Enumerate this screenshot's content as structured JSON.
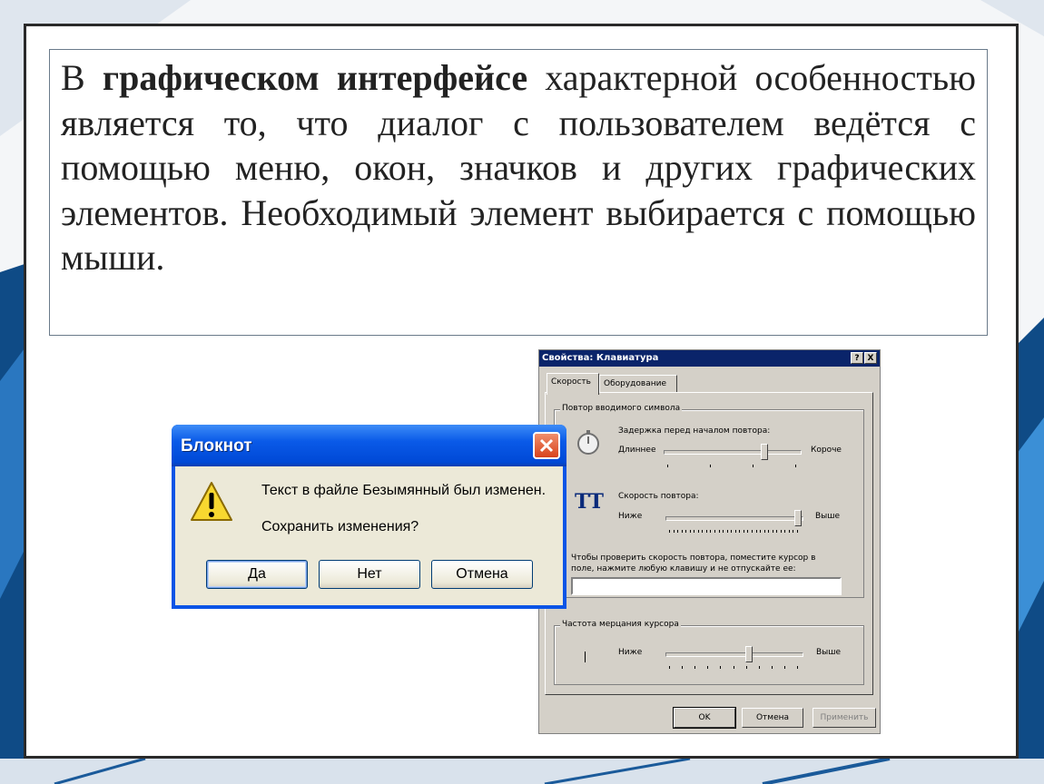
{
  "slide": {
    "text_part1": "В ",
    "text_bold": "графическом интерфейсе",
    "text_part2": " характерной особенностью является то, что диалог с пользователем ведётся с помощью меню, окон, значков и других графических элементов. Необходимый элемент выбирается с помощью мыши."
  },
  "keyboard_dialog": {
    "title": "Свойства: Клавиатура",
    "help_label": "?",
    "close_label": "X",
    "tabs": [
      {
        "label": "Скорость",
        "active": true
      },
      {
        "label": "Оборудование",
        "active": false
      }
    ],
    "repeat_group": {
      "title": "Повтор вводимого символа",
      "delay_label": "Задержка перед началом повтора:",
      "delay_left": "Длиннее",
      "delay_right": "Короче",
      "delay_level": 0.75,
      "speed_label": "Скорость повтора:",
      "speed_left": "Ниже",
      "speed_right": "Выше",
      "speed_level": 1.0,
      "test_label_line1": "Чтобы проверить скорость повтора, поместите курсор в",
      "test_label_line2": "поле, нажмите любую клавишу и не отпускайте ее:",
      "test_value": ""
    },
    "cursor_group": {
      "title": "Частота мерцания курсора",
      "left": "Ниже",
      "right": "Выше",
      "level": 0.62
    },
    "buttons": {
      "ok": "OK",
      "cancel": "Отмена",
      "apply": "Применить"
    }
  },
  "notepad_dialog": {
    "title": "Блокнот",
    "message_line1": "Текст в файле Безымянный был изменен.",
    "message_line2": "Сохранить изменения?",
    "buttons": {
      "yes": "Да",
      "no": "Нет",
      "cancel": "Отмена"
    }
  },
  "icons": [
    "warning-icon",
    "close-icon",
    "stopwatch-icon",
    "repeat-letters-icon",
    "cursor-icon"
  ],
  "colors": {
    "xp_title": "#0a54e6",
    "classic_title": "#0a246a",
    "dialog_face": "#ece9d8",
    "classic_face": "#d4d0c8"
  }
}
